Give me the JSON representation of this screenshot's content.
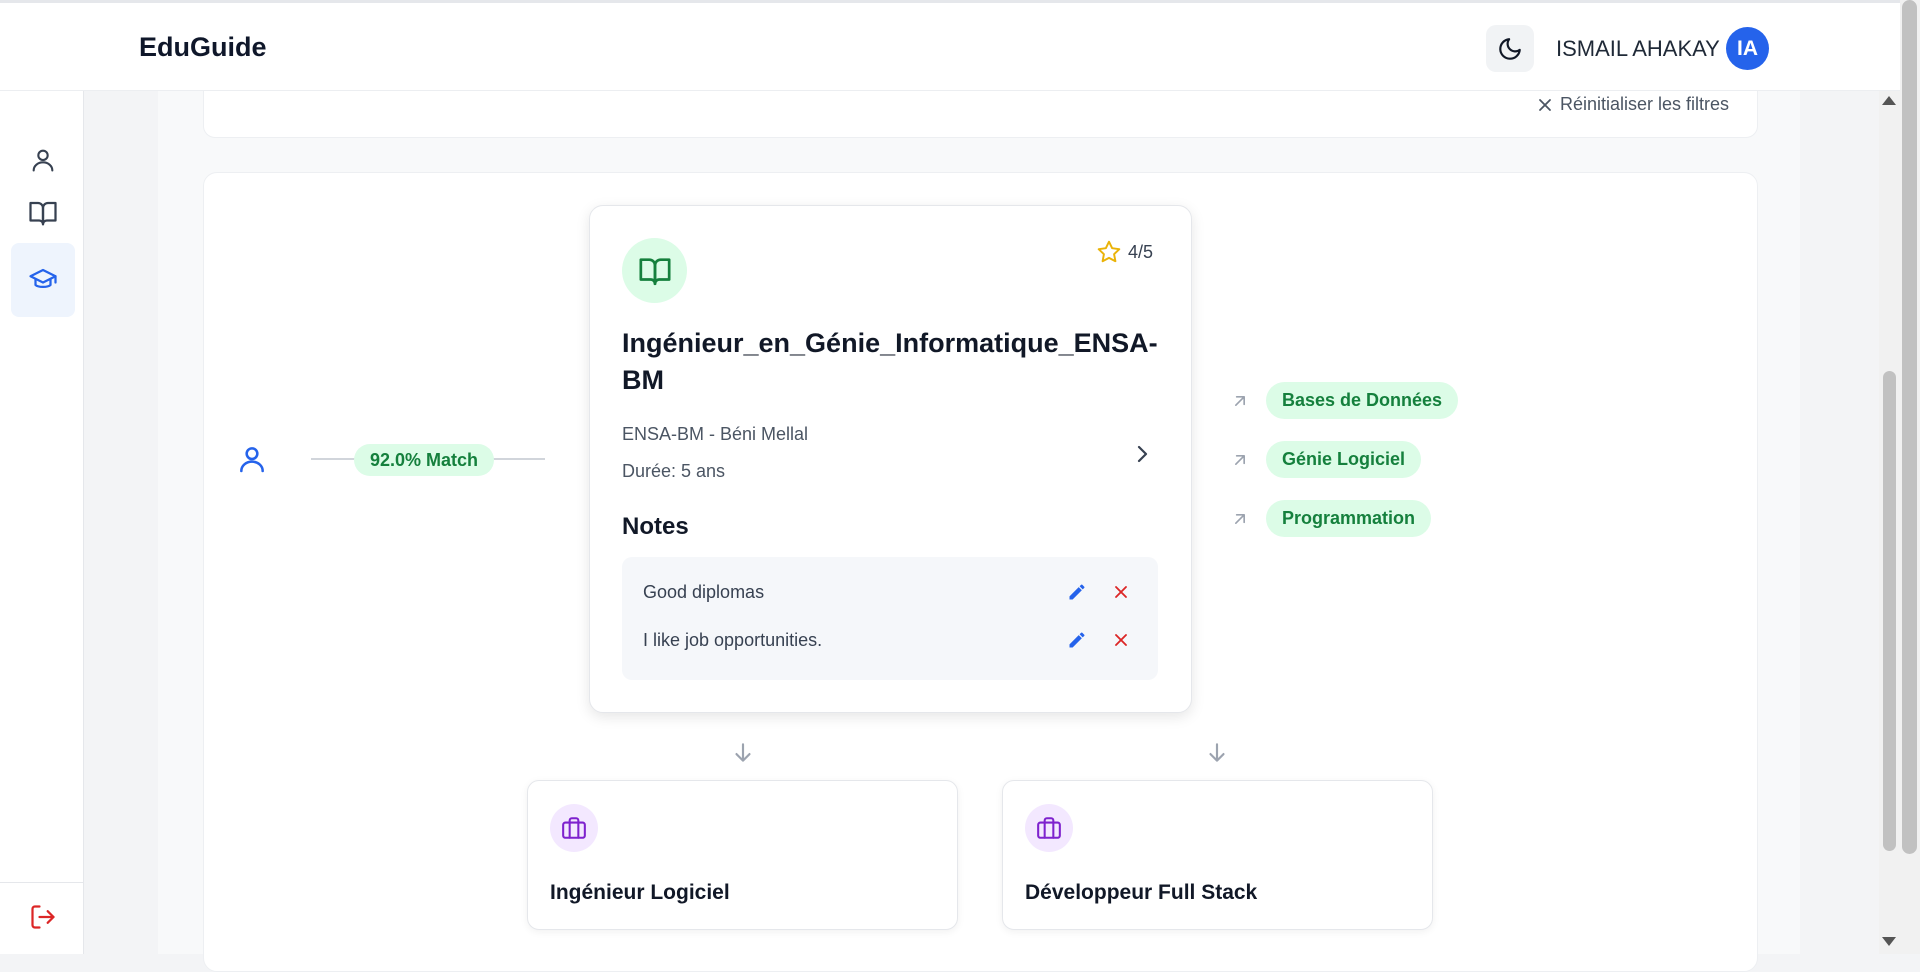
{
  "header": {
    "logo": "EduGuide",
    "user_name": "ISMAIL AHAKAY",
    "avatar_initials": "IA"
  },
  "sidebar": {
    "items": [
      {
        "icon": "user-icon"
      },
      {
        "icon": "book-icon"
      },
      {
        "icon": "graduation-cap-icon",
        "active": true
      }
    ],
    "logout_icon": "logout-icon"
  },
  "filters": {
    "reset_label": "Réinitialiser les filtres"
  },
  "graph": {
    "match_label": "92.0% Match",
    "diploma": {
      "rating": "4/5",
      "title": "Ingénieur_en_Génie_Informatique_ENSA-BM",
      "school": "ENSA-BM - Béni Mellal",
      "duration": "Durée: 5 ans",
      "notes_heading": "Notes",
      "notes": [
        {
          "text": "Good diplomas"
        },
        {
          "text": "I like job opportunities."
        }
      ]
    },
    "subjects": [
      {
        "label": "Bases de Données"
      },
      {
        "label": "Génie Logiciel"
      },
      {
        "label": "Programmation"
      }
    ],
    "jobs": [
      {
        "title": "Ingénieur Logiciel"
      },
      {
        "title": "Développeur Full Stack"
      }
    ]
  },
  "colors": {
    "accent": "#2563eb",
    "success": "#15803d",
    "success_bg": "#dcfce7",
    "danger": "#dc2626",
    "job_icon": "#7e22ce",
    "job_icon_bg": "#f3e8ff",
    "star": "#eab308"
  }
}
